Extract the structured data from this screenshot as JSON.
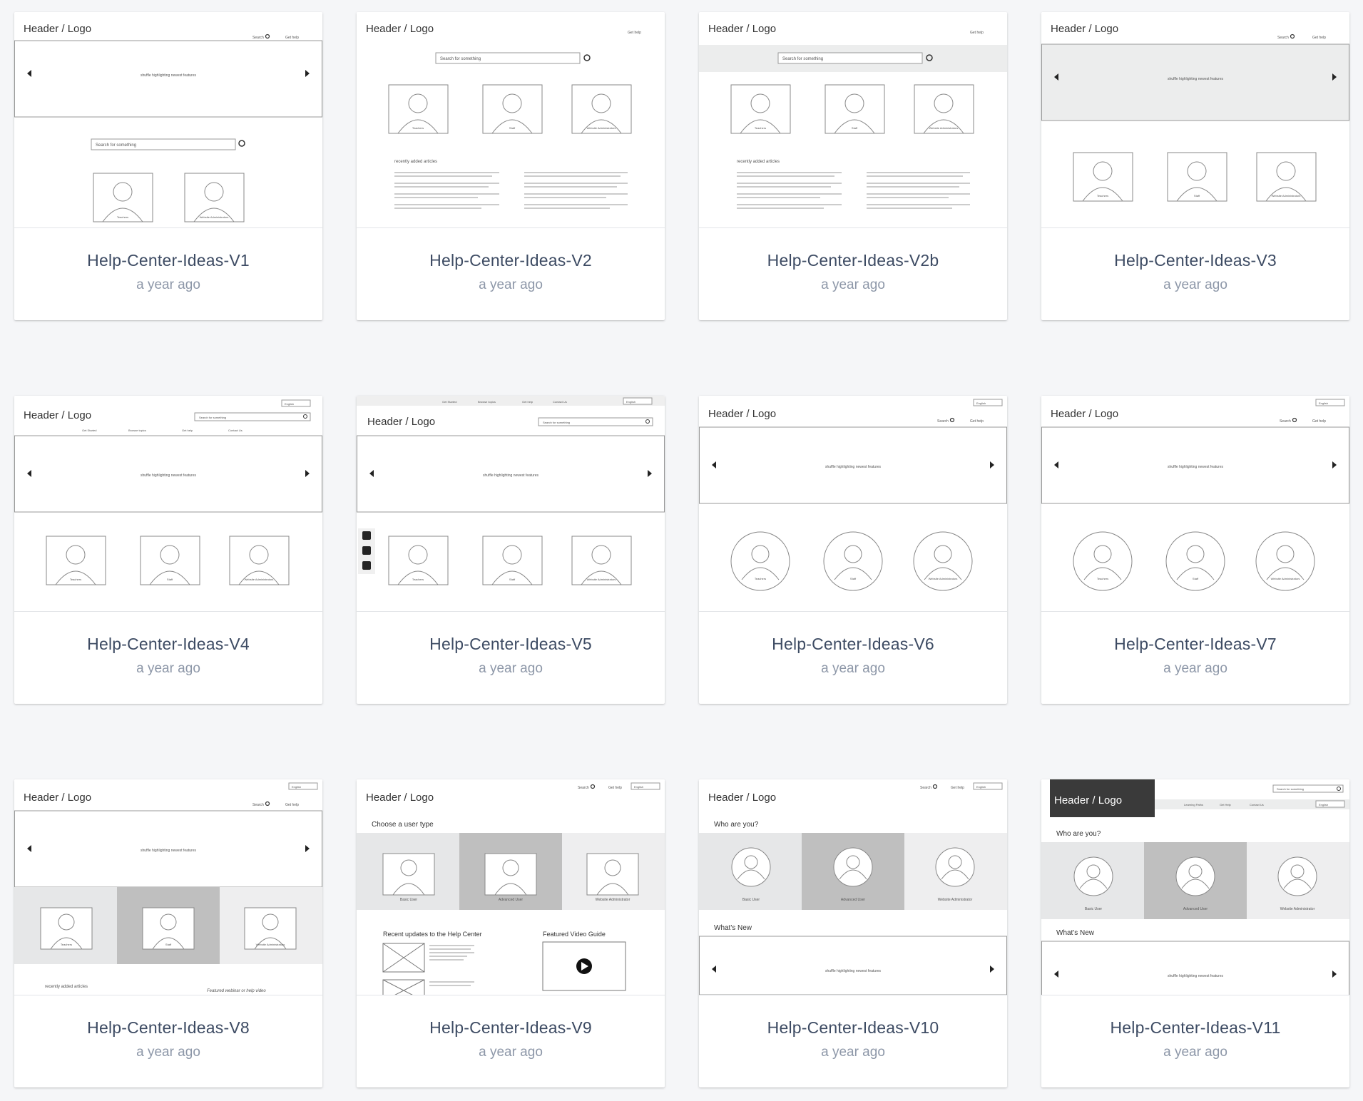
{
  "wireframe": {
    "header_logo": "Header / Logo",
    "search": "Search",
    "get_help": "Get help",
    "search_placeholder": "Search for something",
    "carousel_text": "shuffle highlighting newest features",
    "teachers": "Teachers",
    "staff": "Staff",
    "website_admins": "Website Administrators",
    "recently_added": "recently added articles",
    "english": "English",
    "nav": [
      "Get Started",
      "Browse topics",
      "Get help",
      "Contact Us"
    ],
    "nav_v11": [
      "Learning Paths",
      "Get Help",
      "Contact Us"
    ],
    "choose_user_type": "Choose a user type",
    "who_are_you": "Who are you?",
    "whats_new": "What's New",
    "basic_user": "Basic User",
    "advanced_user": "Advanced User",
    "website_administrator": "Website Administrator",
    "recent_updates": "Recent updates to the Help Center",
    "featured_video": "Featured Video Guide",
    "featured_webinar": "Featured webinar or help video"
  },
  "cards": [
    {
      "title": "Help-Center-Ideas-V1",
      "time": "a year ago"
    },
    {
      "title": "Help-Center-Ideas-V2",
      "time": "a year ago"
    },
    {
      "title": "Help-Center-Ideas-V2b",
      "time": "a year ago"
    },
    {
      "title": "Help-Center-Ideas-V3",
      "time": "a year ago"
    },
    {
      "title": "Help-Center-Ideas-V4",
      "time": "a year ago"
    },
    {
      "title": "Help-Center-Ideas-V5",
      "time": "a year ago"
    },
    {
      "title": "Help-Center-Ideas-V6",
      "time": "a year ago"
    },
    {
      "title": "Help-Center-Ideas-V7",
      "time": "a year ago"
    },
    {
      "title": "Help-Center-Ideas-V8",
      "time": "a year ago"
    },
    {
      "title": "Help-Center-Ideas-V9",
      "time": "a year ago"
    },
    {
      "title": "Help-Center-Ideas-V10",
      "time": "a year ago"
    },
    {
      "title": "Help-Center-Ideas-V11",
      "time": "a year ago"
    }
  ],
  "colors": {
    "page_background": "#f5f6f8",
    "card_title": "#3d4b63",
    "card_time": "#8d97a8"
  }
}
